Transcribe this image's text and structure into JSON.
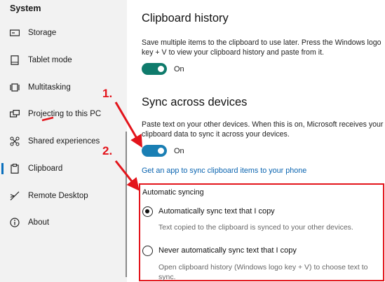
{
  "sidebar": {
    "title": "System",
    "items": [
      {
        "label": "Storage",
        "icon": "storage-icon"
      },
      {
        "label": "Tablet mode",
        "icon": "tablet-mode-icon"
      },
      {
        "label": "Multitasking",
        "icon": "multitasking-icon"
      },
      {
        "label": "Projecting to this PC",
        "icon": "projecting-icon"
      },
      {
        "label": "Shared experiences",
        "icon": "shared-experiences-icon"
      },
      {
        "label": "Clipboard",
        "icon": "clipboard-icon"
      },
      {
        "label": "Remote Desktop",
        "icon": "remote-desktop-icon"
      },
      {
        "label": "About",
        "icon": "info-icon"
      }
    ],
    "active": "Clipboard"
  },
  "main": {
    "history": {
      "heading": "Clipboard history",
      "description": "Save multiple items to the clipboard to use later. Press the Windows logo key + V to view your clipboard history and paste from it.",
      "toggle_state": "On"
    },
    "sync": {
      "heading": "Sync across devices",
      "description": "Paste text on your other devices. When this is on, Microsoft receives your clipboard data to sync it across your devices.",
      "toggle_state": "On",
      "link": "Get an app to sync clipboard items to your phone"
    },
    "auto_sync": {
      "heading": "Automatic syncing",
      "options": [
        {
          "label": "Automatically sync text that I copy",
          "description": "Text copied to the clipboard is synced to your other devices.",
          "selected": true
        },
        {
          "label": "Never automatically sync text that I copy",
          "description": "Open clipboard history (Windows logo key + V) to choose text to sync.",
          "selected": false
        }
      ]
    }
  },
  "annotations": {
    "step1": "1.",
    "step2": "2.",
    "color": "#e3141b"
  },
  "colors": {
    "accent": "#0f7b6c",
    "link": "#0a64b0",
    "sidebar_bg": "#f2f2f2"
  }
}
